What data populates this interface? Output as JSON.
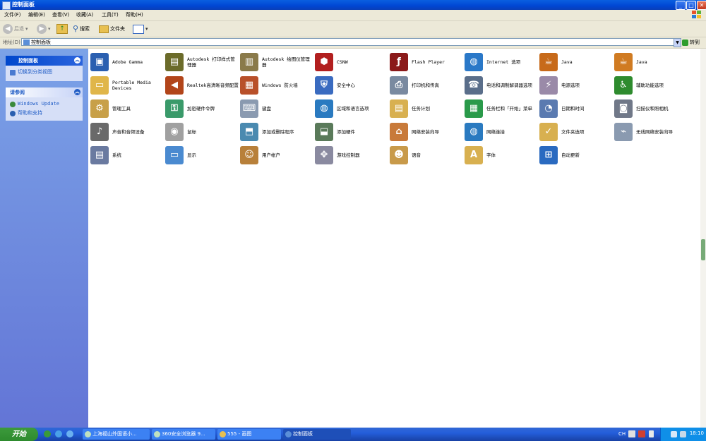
{
  "window": {
    "title": "控制面板"
  },
  "menu": [
    "文件(F)",
    "编辑(E)",
    "查看(V)",
    "收藏(A)",
    "工具(T)",
    "帮助(H)"
  ],
  "toolbar": {
    "back": "后退",
    "search": "搜索",
    "folders": "文件夹"
  },
  "address": {
    "label": "地址(D)",
    "value": "控制面板",
    "go": "转到"
  },
  "sidebar": {
    "panel_title": "控制面板",
    "switch_view": "切换到分类视图",
    "see_also_title": "请参阅",
    "links": [
      "Windows Update",
      "帮助和支持"
    ]
  },
  "items": [
    {
      "label": "Adobe Gamma",
      "color": "#2a5fb0",
      "glyph": "▣"
    },
    {
      "label": "Autodesk 打印样式管理器",
      "color": "#6b6b2a",
      "glyph": "▤"
    },
    {
      "label": "Autodesk 绘图仪管理器",
      "color": "#8a7a4a",
      "glyph": "▥"
    },
    {
      "label": "CSNW",
      "color": "#b21f1f",
      "glyph": "⬢"
    },
    {
      "label": "Flash Player",
      "color": "#8b1a1a",
      "glyph": "ƒ"
    },
    {
      "label": "Internet 选项",
      "color": "#2a78c8",
      "glyph": "◍"
    },
    {
      "label": "Java",
      "color": "#c76a1a",
      "glyph": "☕"
    },
    {
      "label": "Java",
      "color": "#d07b22",
      "glyph": "☕"
    },
    {
      "label": "Portable Media Devices",
      "color": "#e0b64a",
      "glyph": "▭"
    },
    {
      "label": "Realtek高清晰音频配置",
      "color": "#b2451a",
      "glyph": "◀"
    },
    {
      "label": "Windows 防火墙",
      "color": "#b8502a",
      "glyph": "▦"
    },
    {
      "label": "安全中心",
      "color": "#3a6bc0",
      "glyph": "⛨"
    },
    {
      "label": "打印机和传真",
      "color": "#7a8aa0",
      "glyph": "⎙"
    },
    {
      "label": "电话和调制解调器选项",
      "color": "#5a6e8a",
      "glyph": "☎"
    },
    {
      "label": "电源选项",
      "color": "#9a8aa8",
      "glyph": "⚡"
    },
    {
      "label": "辅助功能选项",
      "color": "#2e8b2e",
      "glyph": "♿"
    },
    {
      "label": "管理工具",
      "color": "#c8a048",
      "glyph": "⚙"
    },
    {
      "label": "加密硬件令牌",
      "color": "#3a9a6a",
      "glyph": "⚿"
    },
    {
      "label": "键盘",
      "color": "#8a9ab0",
      "glyph": "⌨"
    },
    {
      "label": "区域和语言选项",
      "color": "#2a7ac0",
      "glyph": "◍"
    },
    {
      "label": "任务计划",
      "color": "#d8b050",
      "glyph": "▤"
    },
    {
      "label": "任务栏和「开始」菜单",
      "color": "#2a9a4a",
      "glyph": "▦"
    },
    {
      "label": "日期和时间",
      "color": "#5a7ab0",
      "glyph": "◔"
    },
    {
      "label": "扫描仪和照相机",
      "color": "#707888",
      "glyph": "◙"
    },
    {
      "label": "声音和音频设备",
      "color": "#6a6a6a",
      "glyph": "♪"
    },
    {
      "label": "鼠标",
      "color": "#a0a0a0",
      "glyph": "◉"
    },
    {
      "label": "添加或删除程序",
      "color": "#4a8ab0",
      "glyph": "⬒"
    },
    {
      "label": "添加硬件",
      "color": "#5a7a5a",
      "glyph": "⬓"
    },
    {
      "label": "网络安装向导",
      "color": "#c87a3a",
      "glyph": "⌂"
    },
    {
      "label": "网络连接",
      "color": "#2a7ac0",
      "glyph": "◍"
    },
    {
      "label": "文件夹选项",
      "color": "#d8b050",
      "glyph": "✓"
    },
    {
      "label": "无线网络安装向导",
      "color": "#8a9ab0",
      "glyph": "⌁"
    },
    {
      "label": "系统",
      "color": "#6a7aa0",
      "glyph": "▤"
    },
    {
      "label": "显示",
      "color": "#4a8ad0",
      "glyph": "▭"
    },
    {
      "label": "用户帐户",
      "color": "#b8803a",
      "glyph": "☺"
    },
    {
      "label": "游戏控制器",
      "color": "#8a8aa0",
      "glyph": "✥"
    },
    {
      "label": "语音",
      "color": "#c89a4a",
      "glyph": "☻"
    },
    {
      "label": "字体",
      "color": "#d8b050",
      "glyph": "A"
    },
    {
      "label": "自动更新",
      "color": "#2a6ac0",
      "glyph": "⊞"
    }
  ],
  "taskbar": {
    "start": "开始",
    "tasks": [
      "上海福山外国语小...",
      "360安全浏览器 9...",
      "555 - 画图",
      "控制面板"
    ],
    "lang": "CH",
    "clock": "18:10"
  }
}
